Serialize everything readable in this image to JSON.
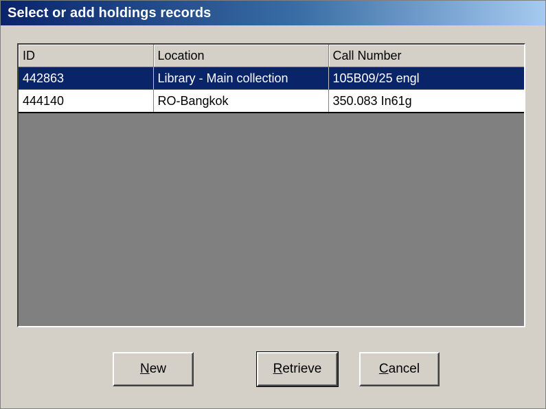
{
  "window": {
    "title": "Select or add holdings records"
  },
  "grid": {
    "columns": [
      "ID",
      "Location",
      "Call Number"
    ],
    "rows": [
      {
        "id": "442863",
        "location": "Library - Main collection",
        "call_number": "105B09/25 engl",
        "selected": true
      },
      {
        "id": "444140",
        "location": "RO-Bangkok",
        "call_number": "350.083 In61g",
        "selected": false
      }
    ]
  },
  "buttons": {
    "new": {
      "mnemonic": "N",
      "rest": "ew"
    },
    "retrieve": {
      "mnemonic": "R",
      "rest": "etrieve"
    },
    "cancel": {
      "mnemonic": "C",
      "rest": "ancel"
    }
  },
  "colors": {
    "selection": "#0a246a",
    "face": "#d4d0c8",
    "grid_background": "#808080"
  }
}
